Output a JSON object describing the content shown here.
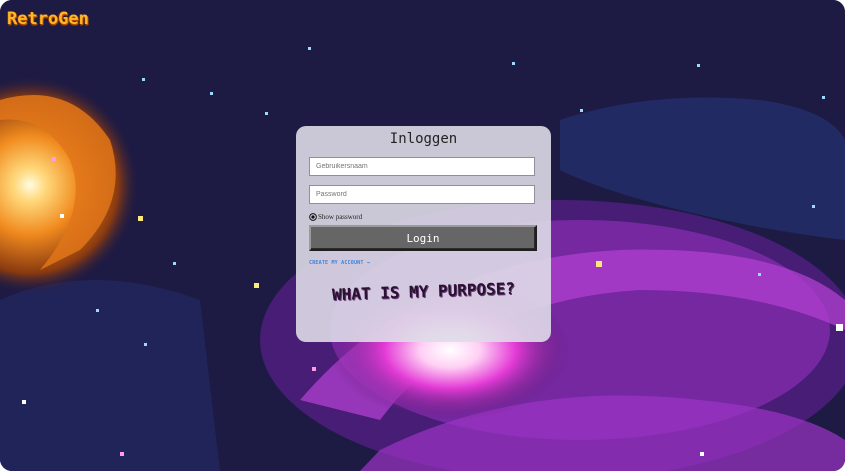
{
  "brand": {
    "logo": "RetroGen"
  },
  "login": {
    "title": "Inloggen",
    "username_placeholder": "Gebruikersnaam",
    "password_placeholder": "Password",
    "show_password_label": "Show password",
    "login_button": "Login",
    "create_account_link": "CREATE MY ACCOUNT →"
  },
  "tagline": "WHAT IS MY PURPOSE?",
  "colors": {
    "logo": "#ffb628",
    "background": "#1d1a44",
    "button": "#666666",
    "link": "#3b83d8"
  }
}
